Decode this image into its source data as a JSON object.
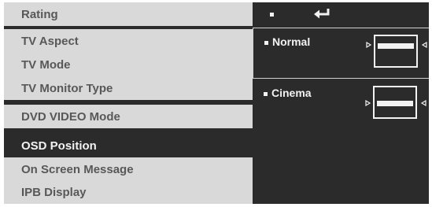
{
  "menu": {
    "items": [
      {
        "label": "Rating"
      },
      {
        "label": "TV Aspect"
      },
      {
        "label": "TV Mode"
      },
      {
        "label": "TV Monitor Type"
      },
      {
        "label": "DVD VIDEO Mode"
      },
      {
        "label": "OSD  Position"
      },
      {
        "label": "On Screen Message"
      },
      {
        "label": "IPB Display"
      }
    ]
  },
  "submenu": {
    "options": [
      {
        "label": "Normal"
      },
      {
        "label": "Cinema"
      }
    ]
  },
  "icons": {
    "header": "return-icon",
    "bullet": "bullet-icon",
    "preview": "screen-position-preview-icon"
  }
}
